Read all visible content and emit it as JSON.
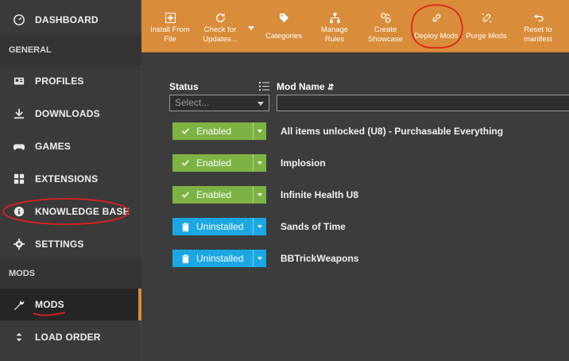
{
  "sidebar": {
    "items": [
      {
        "label": "DASHBOARD",
        "icon": "dashboard-icon"
      },
      {
        "section": "GENERAL"
      },
      {
        "label": "PROFILES",
        "icon": "profiles-icon"
      },
      {
        "label": "DOWNLOADS",
        "icon": "download-icon"
      },
      {
        "label": "GAMES",
        "icon": "gamepad-icon"
      },
      {
        "label": "EXTENSIONS",
        "icon": "puzzle-icon"
      },
      {
        "label": "KNOWLEDGE BASE",
        "icon": "info-icon"
      },
      {
        "label": "SETTINGS",
        "icon": "gear-icon"
      },
      {
        "section": "MODS"
      },
      {
        "label": "MODS",
        "icon": "wrench-icon",
        "active": true
      },
      {
        "label": "LOAD ORDER",
        "icon": "sort-icon"
      }
    ]
  },
  "toolbar": {
    "buttons": [
      {
        "label": "Install From\nFile",
        "icon": "plus-icon"
      },
      {
        "label": "Check for\nUpdates...",
        "icon": "refresh-icon"
      },
      {
        "label": "Categories",
        "icon": "tag-icon"
      },
      {
        "label": "Manage\nRules",
        "icon": "sitemap-icon"
      },
      {
        "label": "Create\nShowcase",
        "icon": "showcase-icon"
      },
      {
        "label": "Deploy Mods",
        "icon": "link-icon"
      },
      {
        "label": "Purge Mods",
        "icon": "unlink-icon"
      },
      {
        "label": "Reset to\nmanifest",
        "icon": "undo-icon"
      }
    ]
  },
  "table": {
    "status_header": "Status",
    "name_header": "Mod Name",
    "status_filter_placeholder": "Select...",
    "rows": [
      {
        "status": "Enabled",
        "name": "All items unlocked (U8) - Purchasable Everything"
      },
      {
        "status": "Enabled",
        "name": "Implosion"
      },
      {
        "status": "Enabled",
        "name": "Infinite Health U8"
      },
      {
        "status": "Uninstalled",
        "name": "Sands of Time"
      },
      {
        "status": "Uninstalled",
        "name": "BBTrickWeapons"
      }
    ]
  },
  "colors": {
    "accent": "#d98c3a",
    "enabled": "#7cb342",
    "uninstalled": "#1aa7e3",
    "annotation": "#e0201c"
  }
}
